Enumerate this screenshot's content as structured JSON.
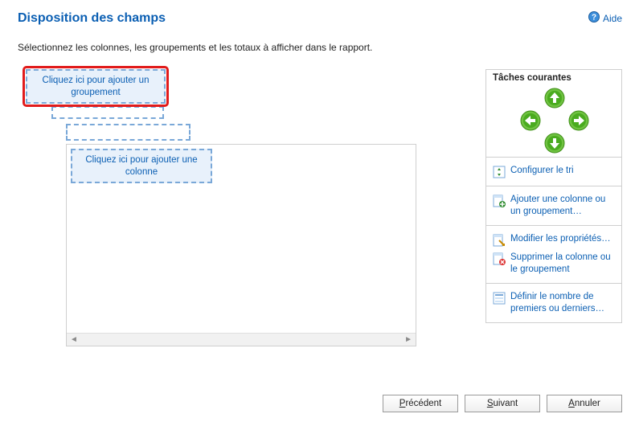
{
  "colors": {
    "accent": "#0b5fb3",
    "arrow": "#38a60d"
  },
  "header": {
    "title": "Disposition des champs",
    "help_label": "Aide"
  },
  "instructions": "Sélectionnez les colonnes, les groupements et les totaux à afficher dans le rapport.",
  "design": {
    "add_group_label": "Cliquez ici pour ajouter un groupement",
    "add_column_label": "Cliquez ici pour ajouter une colonne"
  },
  "tasks": {
    "header": "Tâches courantes",
    "sort_label": "Configurer le tri",
    "add_label": "Ajouter une colonne ou un groupement…",
    "edit_label": "Modifier les propriétés…",
    "delete_label": "Supprimer la colonne ou le groupement",
    "topn_label": "Définir le nombre de premiers ou derniers…"
  },
  "footer": {
    "prev": {
      "u": "P",
      "rest": "récédent"
    },
    "next": {
      "u": "S",
      "rest": "uivant"
    },
    "cancel": {
      "u": "A",
      "rest": "nnuler"
    }
  }
}
